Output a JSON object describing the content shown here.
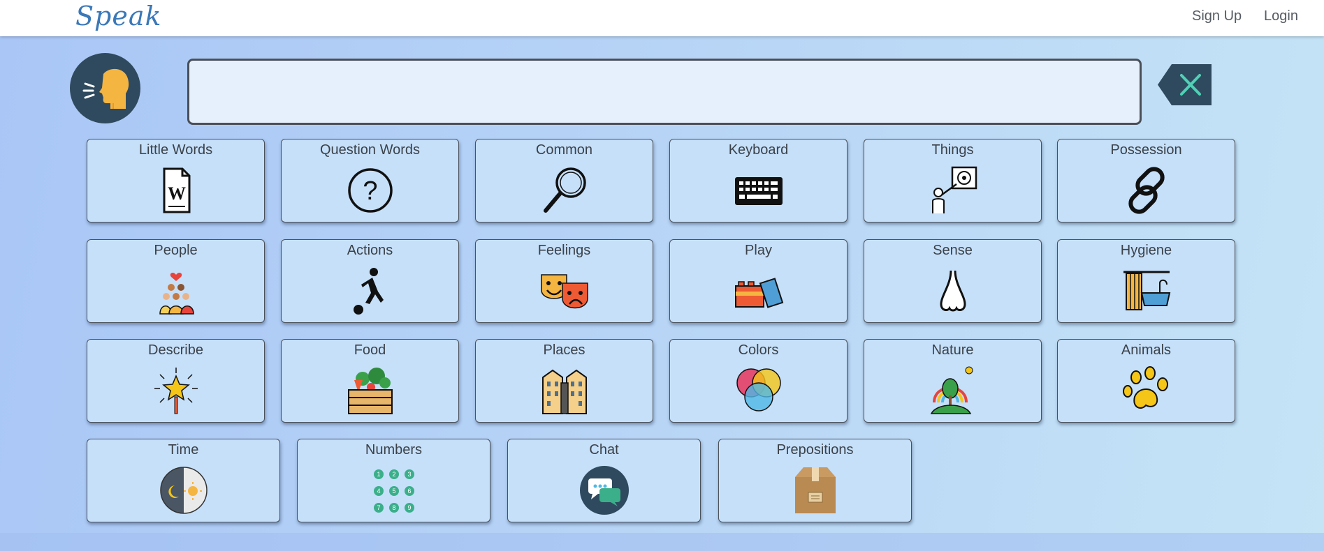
{
  "navbar": {
    "brand": "Speak",
    "sign_up": "Sign Up",
    "login": "Login"
  },
  "speech_bar": {
    "value": ""
  },
  "icons": {
    "speaker": "speaking-head-icon",
    "clear": "backspace-clear-icon"
  },
  "colors": {
    "tile_bg": "#c6e0fa",
    "tile_border": "#4b5159",
    "speaker_bg": "#2f4a5e",
    "clear_bg": "#2f4a5e",
    "clear_x": "#4fd1b6",
    "brand": "#3a78b8"
  },
  "categories": [
    {
      "label": "Little Words",
      "icon": "word-document-icon"
    },
    {
      "label": "Question Words",
      "icon": "question-mark-icon"
    },
    {
      "label": "Common",
      "icon": "magnifying-glass-icon"
    },
    {
      "label": "Keyboard",
      "icon": "keyboard-icon"
    },
    {
      "label": "Things",
      "icon": "teacher-pointing-board-icon"
    },
    {
      "label": "Possession",
      "icon": "chain-link-icon"
    },
    {
      "label": "People",
      "icon": "group-of-people-icon"
    },
    {
      "label": "Actions",
      "icon": "person-kicking-ball-icon"
    },
    {
      "label": "Feelings",
      "icon": "theater-masks-icon"
    },
    {
      "label": "Play",
      "icon": "toy-blocks-icon"
    },
    {
      "label": "Sense",
      "icon": "nose-icon"
    },
    {
      "label": "Hygiene",
      "icon": "bathtub-icon"
    },
    {
      "label": "Describe",
      "icon": "magic-wand-star-icon"
    },
    {
      "label": "Food",
      "icon": "vegetable-crate-icon"
    },
    {
      "label": "Places",
      "icon": "buildings-icon"
    },
    {
      "label": "Colors",
      "icon": "color-circles-icon"
    },
    {
      "label": "Nature",
      "icon": "tree-rainbow-icon"
    },
    {
      "label": "Animals",
      "icon": "paw-print-icon"
    },
    {
      "label": "Time",
      "icon": "day-night-clock-icon"
    },
    {
      "label": "Numbers",
      "icon": "number-grid-icon"
    },
    {
      "label": "Chat",
      "icon": "chat-bubbles-icon"
    },
    {
      "label": "Prepositions",
      "icon": "cardboard-box-icon"
    }
  ]
}
